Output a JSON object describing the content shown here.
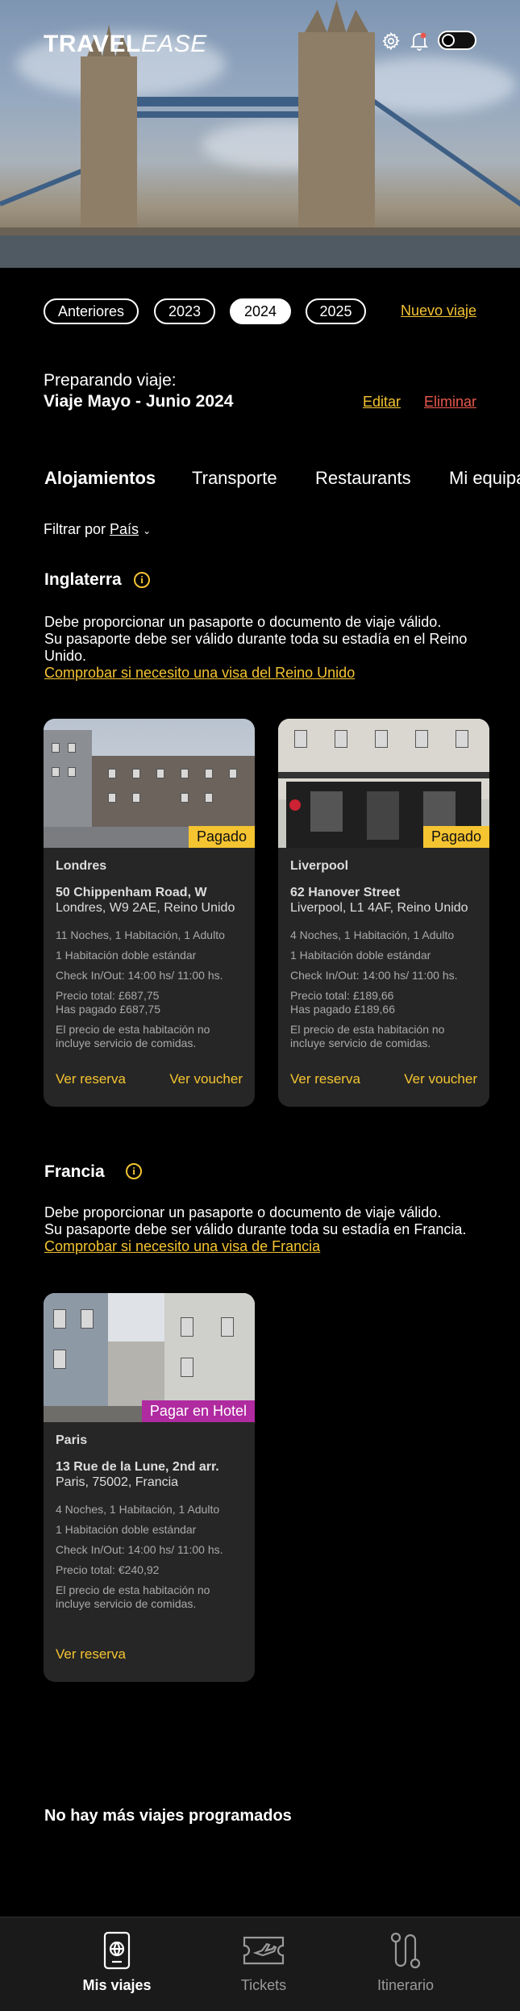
{
  "header": {
    "logo_bold": "TRAVEL",
    "logo_light": "EASE",
    "icons": [
      "gear-icon",
      "bell-icon",
      "theme-toggle"
    ]
  },
  "years": {
    "items": [
      "Anteriores",
      "2023",
      "2024",
      "2025"
    ],
    "active": "2024",
    "new_trip": "Nuevo viaje"
  },
  "trip": {
    "preparing_label": "Preparando viaje:",
    "name": "Viaje Mayo - Junio 2024",
    "edit": "Editar",
    "delete": "Eliminar"
  },
  "tabs": [
    "Alojamientos",
    "Transporte",
    "Restaurants",
    "Mi equipaje"
  ],
  "filter": {
    "label": "Filtrar por",
    "value": "País"
  },
  "countries": [
    {
      "name": "Inglaterra",
      "notice_line1": "Debe proporcionar un pasaporte o documento de viaje válido.",
      "notice_line2": "Su pasaporte debe ser válido durante toda su estadía en el Reino Unido.",
      "visa_link": "Comprobar si necesito una visa del Reino Unido",
      "hotels": [
        {
          "badge": "Pagado",
          "city": "Londres",
          "address1": "50 Chippenham Road, W",
          "address2": "Londres, W9 2AE, Reino Unido",
          "stay": "11 Noches, 1 Habitación, 1 Adulto",
          "room": "1 Habitación doble estándar",
          "checkin": "Check In/Out: 14:00 hs/ 11:00 hs.",
          "total": "Precio total: £687,75",
          "paid": "Has pagado £687,75",
          "meal_note": "El precio de esta habitación no incluye servicio de comidas.",
          "view_booking": "Ver reserva",
          "view_voucher": "Ver voucher"
        },
        {
          "badge": "Pagado",
          "city": "Liverpool",
          "address1": "62 Hanover Street",
          "address2": "Liverpool, L1 4AF, Reino Unido",
          "stay": "4 Noches, 1 Habitación, 1 Adulto",
          "room": "1 Habitación doble estándar",
          "checkin": "Check In/Out: 14:00 hs/ 11:00 hs.",
          "total": "Precio total: £189,66",
          "paid": "Has pagado £189,66",
          "meal_note": "El precio de esta habitación no incluye servicio de comidas.",
          "view_booking": "Ver reserva",
          "view_voucher": "Ver voucher"
        }
      ]
    },
    {
      "name": "Francia",
      "notice_line1": "Debe proporcionar un pasaporte o documento de viaje válido.",
      "notice_line2": "Su pasaporte debe ser válido durante toda su estadía en Francia.",
      "visa_link": "Comprobar si necesito una visa de Francia",
      "hotels": [
        {
          "badge": "Pagar en Hotel",
          "city": "Paris",
          "address1": "13 Rue de la Lune, 2nd arr.",
          "address2": "Paris, 75002, Francia",
          "stay": "4 Noches, 1 Habitación, 1 Adulto",
          "room": "1 Habitación doble estándar",
          "checkin": "Check In/Out: 14:00 hs/ 11:00 hs.",
          "total": "Precio total: €240,92",
          "meal_note": "El precio de esta habitación no incluye servicio de comidas.",
          "view_booking": "Ver reserva"
        }
      ]
    }
  ],
  "no_more": "No hay más viajes programados",
  "bottom_nav": [
    {
      "label": "Mis viajes",
      "icon": "passport-icon",
      "active": true
    },
    {
      "label": "Tickets",
      "icon": "ticket-icon",
      "active": false
    },
    {
      "label": "Itinerario",
      "icon": "route-icon",
      "active": false
    }
  ],
  "colors": {
    "accent_yellow": "#f5c431",
    "danger_red": "#e8584d",
    "badge_magenta": "#b02aa0",
    "card_bg": "#262626"
  }
}
